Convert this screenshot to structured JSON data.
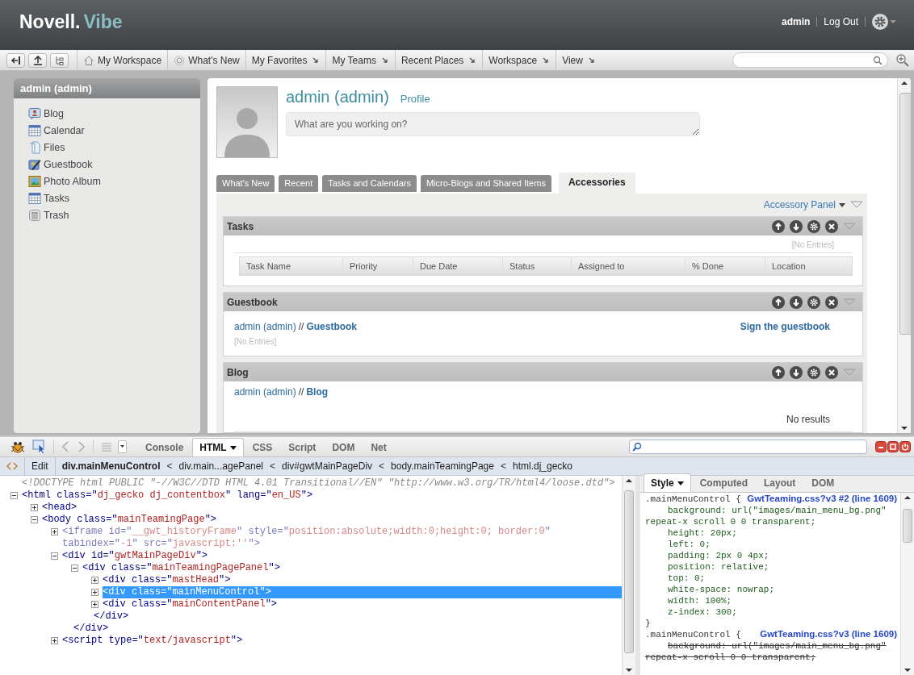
{
  "masthead": {
    "brand": "Novell.",
    "product": "Vibe",
    "user": "admin",
    "logout": "Log Out"
  },
  "toolbar": {
    "nav": [
      {
        "label": "My Workspace",
        "kind": "home"
      },
      {
        "label": "What's New",
        "kind": "news"
      },
      {
        "label": "My Favorites",
        "kind": "menu"
      },
      {
        "label": "My Teams",
        "kind": "menu"
      },
      {
        "label": "Recent Places",
        "kind": "menu"
      },
      {
        "label": "Workspace",
        "kind": "menu"
      },
      {
        "label": "View",
        "kind": "menu"
      }
    ]
  },
  "sidebar": {
    "title": "admin (admin)",
    "items": [
      {
        "label": "Blog",
        "kind": "blog"
      },
      {
        "label": "Calendar",
        "kind": "calendar"
      },
      {
        "label": "Files",
        "kind": "files"
      },
      {
        "label": "Guestbook",
        "kind": "guestbook"
      },
      {
        "label": "Photo Album",
        "kind": "photo"
      },
      {
        "label": "Tasks",
        "kind": "tasks"
      },
      {
        "label": "Trash",
        "kind": "trash"
      }
    ]
  },
  "profile": {
    "name": "admin (admin)",
    "link": "Profile",
    "placeholder": "What are you working on?"
  },
  "tabs": [
    {
      "label": "What's New",
      "selected": false
    },
    {
      "label": "Recent",
      "selected": false
    },
    {
      "label": "Tasks and Calendars",
      "selected": false
    },
    {
      "label": "Micro-Blogs and Shared Items",
      "selected": false
    },
    {
      "label": "Accessories",
      "selected": true
    }
  ],
  "accessory_panel": {
    "label": "Accessory Panel",
    "accessories": [
      {
        "kind": "tasks",
        "title": "Tasks",
        "empty": "[No Entries]",
        "columns": [
          "Task Name",
          "Priority",
          "Due Date",
          "Status",
          "Assigned to",
          "% Done",
          "Location"
        ]
      },
      {
        "kind": "guestbook",
        "title": "Guestbook",
        "owner": "admin (admin)",
        "separator": "//",
        "folder": "Guestbook",
        "action": "Sign the guestbook",
        "empty": "[No Entries]"
      },
      {
        "kind": "blog",
        "title": "Blog",
        "owner": "admin (admin)",
        "separator": "//",
        "folder": "Blog",
        "empty": "No results"
      }
    ]
  },
  "firebug": {
    "tabs": [
      {
        "label": "Console",
        "selected": false,
        "menu": false
      },
      {
        "label": "HTML",
        "selected": true,
        "menu": true
      },
      {
        "label": "CSS",
        "selected": false,
        "menu": false
      },
      {
        "label": "Script",
        "selected": false,
        "menu": false
      },
      {
        "label": "DOM",
        "selected": false,
        "menu": false
      },
      {
        "label": "Net",
        "selected": false,
        "menu": false
      }
    ],
    "breadcrumb": {
      "edit": "Edit",
      "separator": "<",
      "path": [
        {
          "label": "div.mainMenuControl",
          "selected": true
        },
        {
          "label": "div.main...agePanel",
          "selected": false
        },
        {
          "label": "div#gwtMainPageDiv",
          "selected": false
        },
        {
          "label": "body.mainTeamingPage",
          "selected": false
        },
        {
          "label": "html.dj_gecko",
          "selected": false
        }
      ]
    },
    "html_tree": [
      {
        "kind": "doctype",
        "selected": false,
        "parts": [
          {
            "kind": "comment",
            "text": "<!DOCTYPE html PUBLIC \"-//W3C//DTD HTML 4.01 Transitional//EN\" \"http://www.w3.org/TR/html4/loose.dtd\">"
          }
        ]
      },
      {
        "kind": "node",
        "expanded": true,
        "dimmed": false,
        "selected": false,
        "parts": [
          {
            "kind": "tag",
            "text": "<html class=\""
          },
          {
            "kind": "value",
            "text": "dj_gecko dj_contentbox"
          },
          {
            "kind": "tag",
            "text": "\" lang=\""
          },
          {
            "kind": "value",
            "text": "en_US"
          },
          {
            "kind": "tag",
            "text": "\">"
          }
        ],
        "children": [
          {
            "kind": "node",
            "expanded": false,
            "dimmed": false,
            "selected": false,
            "parts": [
              {
                "kind": "tag",
                "text": "<head>"
              }
            ]
          },
          {
            "kind": "node",
            "expanded": true,
            "dimmed": false,
            "selected": false,
            "parts": [
              {
                "kind": "tag",
                "text": "<body class=\""
              },
              {
                "kind": "value",
                "text": "mainTeamingPage"
              },
              {
                "kind": "tag",
                "text": "\">"
              }
            ],
            "children": [
              {
                "kind": "node",
                "expanded": false,
                "dimmed": true,
                "selected": false,
                "parts": [
                  {
                    "kind": "tag",
                    "text": "<iframe id=\""
                  },
                  {
                    "kind": "value",
                    "text": "__gwt_historyFrame"
                  },
                  {
                    "kind": "tag",
                    "text": "\" style=\""
                  },
                  {
                    "kind": "value",
                    "text": "position:absolute;width:0;height:0; border:0"
                  },
                  {
                    "kind": "tag",
                    "text": "\" tabindex=\""
                  },
                  {
                    "kind": "value",
                    "text": "-1"
                  },
                  {
                    "kind": "tag",
                    "text": "\" src=\""
                  },
                  {
                    "kind": "value",
                    "text": "javascript:''"
                  },
                  {
                    "kind": "tag",
                    "text": "\">"
                  }
                ]
              },
              {
                "kind": "node",
                "expanded": true,
                "dimmed": false,
                "selected": false,
                "parts": [
                  {
                    "kind": "tag",
                    "text": "<div id=\""
                  },
                  {
                    "kind": "value",
                    "text": "gwtMainPageDiv"
                  },
                  {
                    "kind": "tag",
                    "text": "\">"
                  }
                ],
                "children": [
                  {
                    "kind": "node",
                    "expanded": true,
                    "dimmed": false,
                    "selected": false,
                    "parts": [
                      {
                        "kind": "tag",
                        "text": "<div class=\""
                      },
                      {
                        "kind": "value",
                        "text": "mainTeamingPagePanel"
                      },
                      {
                        "kind": "tag",
                        "text": "\">"
                      }
                    ],
                    "children": [
                      {
                        "kind": "node",
                        "expanded": false,
                        "dimmed": false,
                        "selected": false,
                        "parts": [
                          {
                            "kind": "tag",
                            "text": "<div class=\""
                          },
                          {
                            "kind": "value",
                            "text": "mastHead"
                          },
                          {
                            "kind": "tag",
                            "text": "\">"
                          }
                        ]
                      },
                      {
                        "kind": "node",
                        "expanded": false,
                        "dimmed": false,
                        "selected": true,
                        "parts": [
                          {
                            "kind": "tag",
                            "text": "<div class=\""
                          },
                          {
                            "kind": "value",
                            "text": "mainMenuControl"
                          },
                          {
                            "kind": "tag",
                            "text": "\">"
                          }
                        ]
                      },
                      {
                        "kind": "node",
                        "expanded": false,
                        "dimmed": false,
                        "selected": false,
                        "parts": [
                          {
                            "kind": "tag",
                            "text": "<div class=\""
                          },
                          {
                            "kind": "value",
                            "text": "mainContentPanel"
                          },
                          {
                            "kind": "tag",
                            "text": "\">"
                          }
                        ]
                      },
                      {
                        "kind": "close",
                        "selected": false,
                        "parts": [
                          {
                            "kind": "tag",
                            "text": "</div>"
                          }
                        ]
                      }
                    ]
                  },
                  {
                    "kind": "close",
                    "selected": false,
                    "parts": [
                      {
                        "kind": "tag",
                        "text": "</div>"
                      }
                    ]
                  }
                ]
              },
              {
                "kind": "node",
                "expanded": false,
                "dimmed": false,
                "selected": false,
                "parts": [
                  {
                    "kind": "tag",
                    "text": "<script type=\""
                  },
                  {
                    "kind": "value",
                    "text": "text/javascript"
                  },
                  {
                    "kind": "tag",
                    "text": "\">"
                  }
                ]
              }
            ]
          }
        ]
      }
    ],
    "side_tabs": [
      {
        "label": "Style",
        "selected": true,
        "menu": true
      },
      {
        "label": "Computed",
        "selected": false,
        "menu": false
      },
      {
        "label": "Layout",
        "selected": false,
        "menu": false
      },
      {
        "label": "DOM",
        "selected": false,
        "menu": false
      }
    ],
    "css_rules": [
      {
        "selector": ".mainMenuControl {",
        "source": "GwtTeaming.css?v3 #2 (line 1609)",
        "lines": [
          {
            "kind": "decl",
            "text": "background: url(\"images/main_menu_bg.png\"",
            "overridden": false
          },
          {
            "kind": "wrap",
            "text": "repeat-x scroll 0 0 transparent;",
            "overridden": false
          },
          {
            "kind": "decl",
            "text": "height: 20px;",
            "overridden": false
          },
          {
            "kind": "decl",
            "text": "left: 0;",
            "overridden": false
          },
          {
            "kind": "decl",
            "text": "padding: 2px 0 4px;",
            "overridden": false
          },
          {
            "kind": "decl",
            "text": "position: relative;",
            "overridden": false
          },
          {
            "kind": "decl",
            "text": "top: 0;",
            "overridden": false
          },
          {
            "kind": "decl",
            "text": "white-space: nowrap;",
            "overridden": false
          },
          {
            "kind": "decl",
            "text": "width: 100%;",
            "overridden": false
          },
          {
            "kind": "decl",
            "text": "z-index: 300;",
            "overridden": false
          },
          {
            "kind": "close",
            "text": "}",
            "overridden": false
          }
        ]
      },
      {
        "selector": ".mainMenuControl {",
        "source": "GwtTeaming.css?v3 (line 1609)",
        "lines": [
          {
            "kind": "decl",
            "text": "background: url(\"images/main_menu_bg.png\"",
            "overridden": true
          },
          {
            "kind": "wrap",
            "text": "repeat-x scroll 0 0 transparent;",
            "overridden": true
          }
        ]
      }
    ]
  }
}
